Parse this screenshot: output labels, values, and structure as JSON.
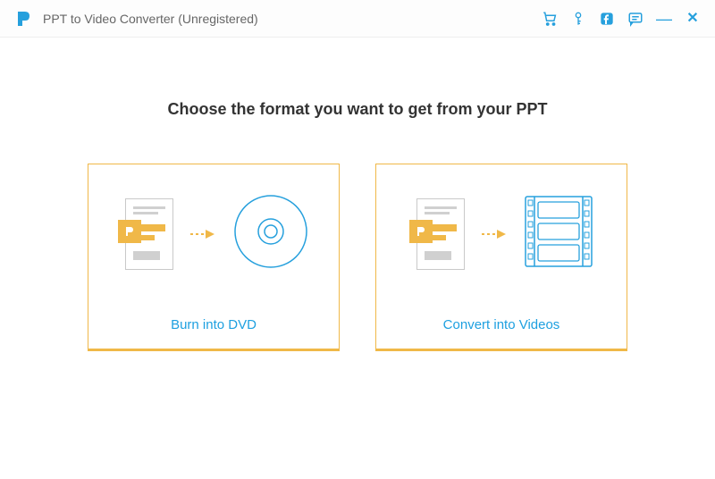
{
  "window": {
    "title": "PPT to Video Converter (Unregistered)"
  },
  "main": {
    "heading": "Choose the format you want to get from your PPT"
  },
  "cards": {
    "dvd": {
      "label": "Burn into DVD"
    },
    "video": {
      "label": "Convert into Videos"
    }
  },
  "colors": {
    "accent_blue": "#1ea0e0",
    "accent_orange": "#f0b848",
    "icon_blue": "#26a0dd"
  }
}
